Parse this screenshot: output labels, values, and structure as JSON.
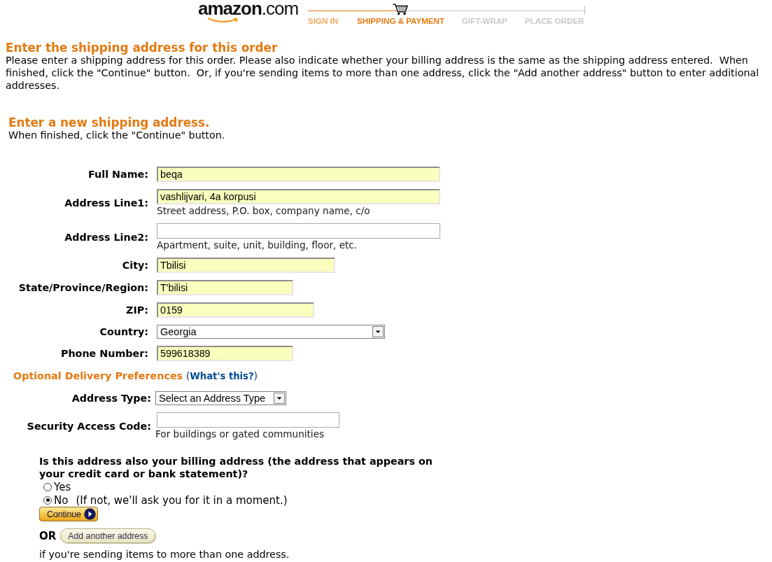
{
  "header": {
    "logo": "**amazon**.com",
    "steps": [
      {
        "label": "SIGN IN",
        "completed": true,
        "selected": false
      },
      {
        "label": "SHIPPING & PAYMENT",
        "completed": false,
        "selected": true
      },
      {
        "label": "GIFT-WRAP",
        "completed": false,
        "selected": false
      },
      {
        "label": "PLACE ORDER",
        "completed": false,
        "selected": false
      }
    ]
  },
  "intro": {
    "title": "Enter the shipping address for this order",
    "text": "Please enter a shipping address for this order. Please also indicate whether your billing address is the same as the shipping address entered.  When finished, click the \"Continue\" button.  Or, if you're sending items to more than one address, click the \"Add another address\" button to enter additional addresses."
  },
  "new_address": {
    "title": "Enter a new shipping address.",
    "text": "When finished, click the \"Continue\" button."
  },
  "address_fields": [
    {
      "kind": "text",
      "label": "Full Name:",
      "value": "beqa",
      "autofilled": true
    },
    {
      "kind": "text",
      "label": "Address Line1:",
      "value": "vashlijvari, 4a korpusi",
      "hint": "Street address, P.O. box, company name, c/o",
      "autofilled": true
    },
    {
      "kind": "text",
      "label": "Address Line2:",
      "hint": "Apartment, suite, unit, building, floor, etc.",
      "autofilled": false
    },
    {
      "kind": "text",
      "label": "City:",
      "value": "Tbilisi",
      "autofilled": true
    },
    {
      "kind": "text",
      "label": "State/Province/Region:",
      "value": "T'bilisi",
      "autofilled": true
    },
    {
      "kind": "text",
      "label": "ZIP:",
      "value": "0159",
      "autofilled": true
    },
    {
      "kind": "select",
      "label": "Country:",
      "value": "Georgia"
    },
    {
      "kind": "text",
      "label": "Phone Number:",
      "value": "599618389",
      "autofilled": true
    }
  ],
  "delivery_preferences": {
    "title": "Optional Delivery Preferences",
    "help_link": {
      "open": "(",
      "label": "What's this?",
      "close": ")"
    },
    "fields": [
      {
        "kind": "select",
        "label": "Address Type:",
        "value": "Select an Address Type"
      },
      {
        "kind": "text",
        "label": "Security Access Code:",
        "hint": "For buildings or gated communities",
        "autofilled": false
      }
    ]
  },
  "billing": {
    "question": "Is this address also your billing address (the address that appears on your credit card or bank statement)?",
    "options": [
      {
        "label": "Yes",
        "selected": false
      },
      {
        "label": "No",
        "note": "(If not, we'll ask you for it in a moment.)",
        "selected": true
      }
    ]
  },
  "actions": {
    "continue_button": "Continue",
    "or_label": "OR",
    "add_button": "Add another address",
    "add_note": "if you're sending items to more than one address."
  }
}
